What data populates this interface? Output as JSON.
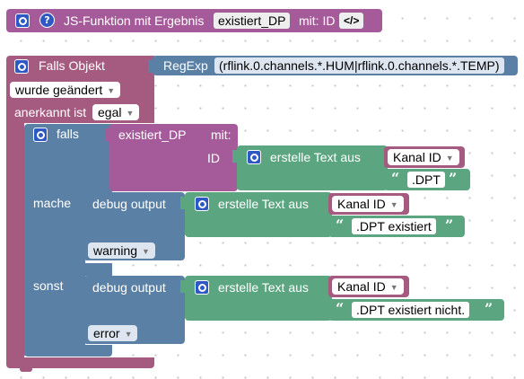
{
  "function_block": {
    "title": "JS-Funktion mit Ergebnis",
    "function_name": "existiert_DP",
    "param_label": "mit: ID",
    "code_label": "</>",
    "color": "#a55b99"
  },
  "trigger_block": {
    "title": "Falls Objekt",
    "regexp_label": "RegExp",
    "regexp_value": "(rflink.0.channels.*.HUM|rflink.0.channels.*.TEMP)",
    "condition_value": "wurde geändert",
    "acknowledged_label": "anerkannt ist",
    "acknowledged_value": "egal",
    "color": "#a55b80"
  },
  "if_block": {
    "if_label": "falls",
    "then_label": "mache",
    "else_label": "sonst",
    "color": "#5b80a5"
  },
  "call_block": {
    "function_name": "existiert_DP",
    "param_label": "mit:",
    "arg_name": "ID"
  },
  "create_text_label": "erstelle Text aus",
  "kanal_id_label": "Kanal ID",
  "text_literals": [
    ".DPT",
    ".DPT existiert",
    ".DPT  existiert nicht."
  ],
  "debug_blocks": [
    {
      "label": "debug output",
      "level": "warning"
    },
    {
      "label": "debug output",
      "level": "error"
    }
  ],
  "colors": {
    "text_block": "#5ba580",
    "variable_block": "#a55b80",
    "function_block": "#a55b99",
    "logic_block": "#5b80a5",
    "regexp_block": "#5b80a5"
  }
}
